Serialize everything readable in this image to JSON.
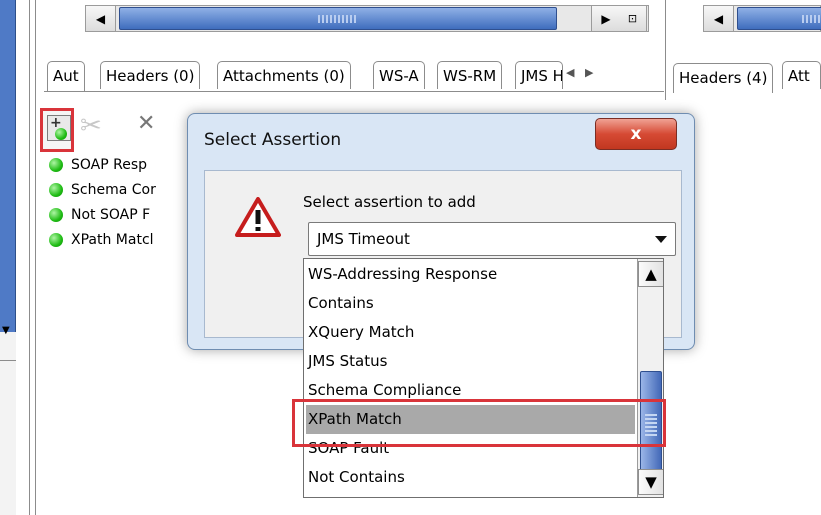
{
  "tabs_left": [
    "Aut",
    "Headers (0)",
    "Attachments (0)",
    "WS-A",
    "WS-RM",
    "JMS H"
  ],
  "tabs_right": [
    "Headers (4)",
    "Att"
  ],
  "assertions": [
    {
      "label": "SOAP Resp"
    },
    {
      "label": "Schema Cor"
    },
    {
      "label": "Not SOAP F"
    },
    {
      "label": "XPath Matcl"
    }
  ],
  "toolbar": {
    "add_icon": "add-assertion-icon",
    "remove_icon": "remove-icon",
    "close_icon": "x-icon"
  },
  "dialog": {
    "title": "Select Assertion",
    "close_label": "x",
    "prompt": "Select assertion to add",
    "selected": "JMS Timeout",
    "icon": "warning-triangle-icon"
  },
  "dropdown": {
    "items": [
      "WS-Addressing Response",
      "Contains",
      "XQuery Match",
      "JMS Status",
      "Schema Compliance",
      "XPath Match",
      "SOAP Fault",
      "Not Contains"
    ],
    "highlighted_index": 5
  },
  "colors": {
    "highlight": "#d9343a",
    "scroll_thumb": "#3f6dbd",
    "status_green": "#1fbc14"
  }
}
